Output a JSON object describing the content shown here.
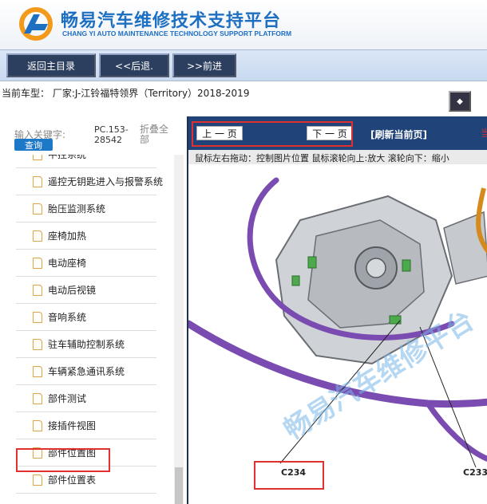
{
  "header": {
    "title": "畅易汽车维修技术支持平台",
    "subtitle": "CHANG YI AUTO MAINTENANCE TECHNOLOGY SUPPORT PLATFORM"
  },
  "toolbar": {
    "home_label": "返回主目录",
    "back_label": "<<后退.",
    "forward_label": ">>前进"
  },
  "vehicle": {
    "text": "当前车型：  厂家:J-江铃福特领界（Territory）2018-2019"
  },
  "left": {
    "search_label": "输入关键字:",
    "query_label": "查询",
    "pc_code": "PC.153-28542",
    "collapse_label": "折叠全部",
    "items": [
      {
        "label": "中控系统"
      },
      {
        "label": "遥控无钥匙进入与报警系统"
      },
      {
        "label": "胎压监测系统"
      },
      {
        "label": "座椅加热"
      },
      {
        "label": "电动座椅"
      },
      {
        "label": "电动后视镜"
      },
      {
        "label": "音响系统"
      },
      {
        "label": "驻车辅助控制系统"
      },
      {
        "label": "车辆紧急通讯系统"
      },
      {
        "label": "部件测试"
      },
      {
        "label": "接插件视图"
      },
      {
        "label": "部件位置图"
      },
      {
        "label": "部件位置表"
      }
    ]
  },
  "viewer": {
    "prev_label": "上 一 页",
    "next_label": "下 一 页",
    "refresh_label": "[刷新当前页]",
    "overflow_label": "当",
    "hint": "鼠标左右拖动：控制图片位置  鼠标滚轮向上:放大  滚轮向下：缩小",
    "watermark": "畅易汽车维修平台",
    "callouts": [
      "C234",
      "C233"
    ]
  },
  "colors": {
    "brand_blue": "#1d6fc2",
    "toolbar_button": "#2d3f5e",
    "nav_bar": "#20447a",
    "highlight": "#e03030"
  }
}
